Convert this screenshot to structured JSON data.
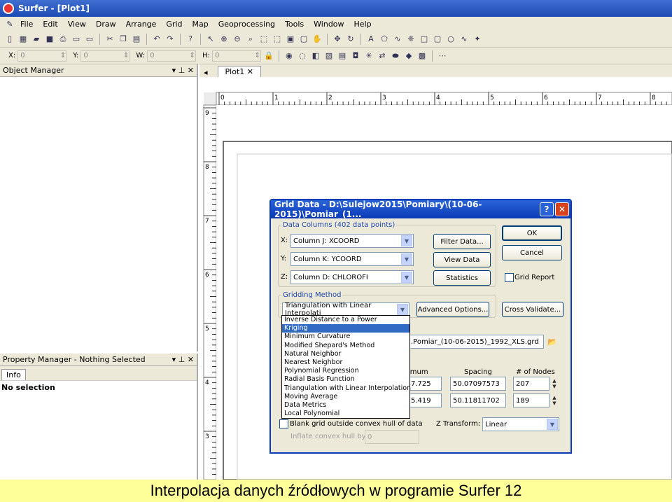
{
  "window": {
    "title": "Surfer - [Plot1]"
  },
  "menu": [
    "File",
    "Edit",
    "View",
    "Draw",
    "Arrange",
    "Grid",
    "Map",
    "Geoprocessing",
    "Tools",
    "Window",
    "Help"
  ],
  "coords": {
    "x_label": "X:",
    "x_value": "0",
    "y_label": "Y:",
    "y_value": "0",
    "w_label": "W:",
    "w_value": "0",
    "h_label": "H:",
    "h_value": "0"
  },
  "object_manager": {
    "title": "Object Manager"
  },
  "property_manager": {
    "title": "Property Manager - Nothing Selected",
    "tab": "Info",
    "status": "No selection"
  },
  "doc_tab": {
    "label": "Plot1"
  },
  "ruler": {
    "h_ticks": [
      "0",
      "1",
      "2",
      "3",
      "4",
      "5",
      "6",
      "7",
      "8"
    ],
    "v_ticks": [
      "9",
      "8",
      "7",
      "6",
      "5",
      "4",
      "3"
    ]
  },
  "dialog": {
    "title": "Grid Data - D:\\Sulejow2015\\Pomiary\\(10-06-2015)\\Pomiar_(1...",
    "data_columns_legend": "Data Columns    (402 data points)",
    "x_label": "X:",
    "x_value": "Column J:  XCOORD",
    "y_label": "Y:",
    "y_value": "Column K:  YCOORD",
    "z_label": "Z:",
    "z_value": "Column D:  CHLOROFI",
    "filter_btn": "Filter Data...",
    "view_btn": "View Data",
    "stats_btn": "Statistics",
    "ok_btn": "OK",
    "cancel_btn": "Cancel",
    "grid_report": "Grid Report",
    "gridding_legend": "Gridding Method",
    "method_value": "Triangulation with Linear Interpolati",
    "advanced_btn": "Advanced Options...",
    "cross_btn": "Cross Validate...",
    "output_file": ".Pomiar_(10-06-2015)_1992_XLS.grd",
    "col_minimum": "imum",
    "col_spacing": "Spacing",
    "col_nodes": "# of Nodes",
    "row1": {
      "min": "7.725",
      "spacing": "50.07097573",
      "nodes": "207"
    },
    "row2": {
      "min": "5.419",
      "spacing": "50.11811702",
      "nodes": "189"
    },
    "blank_grid": "Blank grid outside convex hull of data",
    "inflate_label": "Inflate convex hull by:",
    "inflate_value": "0",
    "ztransform_label": "Z Transform:",
    "ztransform_value": "Linear"
  },
  "dropdown_options": [
    "Inverse Distance to a Power",
    "Kriging",
    "Minimum Curvature",
    "Modified Shepard's Method",
    "Natural Neighbor",
    "Nearest Neighbor",
    "Polynomial Regression",
    "Radial Basis Function",
    "Triangulation with Linear Interpolation",
    "Moving Average",
    "Data Metrics",
    "Local Polynomial"
  ],
  "dropdown_selected": "Kriging",
  "caption": "Interpolacja danych źródłowych w programie Surfer 12"
}
